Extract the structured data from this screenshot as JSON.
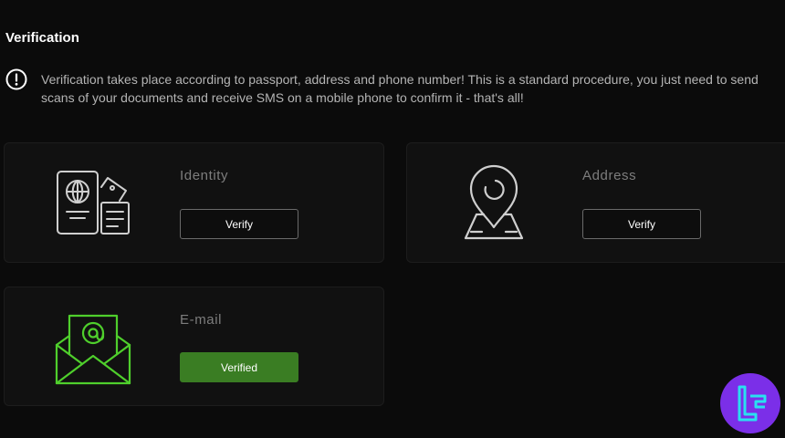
{
  "page": {
    "title": "Verification",
    "notice": "Verification takes place according to passport, address and phone number! This is a standard procedure, you just need to send scans of your documents and receive SMS on a mobile phone to confirm it - that's all!",
    "notice_icon": "exclamation-circle-icon"
  },
  "cards": {
    "identity": {
      "title": "Identity",
      "button_label": "Verify",
      "icon": "passport-icon"
    },
    "address": {
      "title": "Address",
      "button_label": "Verify",
      "icon": "map-pin-icon"
    },
    "email": {
      "title": "E-mail",
      "button_label": "Verified",
      "icon": "envelope-at-icon"
    }
  },
  "colors": {
    "background": "#0b0b0b",
    "card": "#111111",
    "verified": "#3a7d23",
    "icon_gray": "#cfcfcf",
    "icon_green": "#4fcf2c",
    "logo_purple": "#7b2fe8",
    "logo_cyan": "#29e0f0"
  },
  "brand": {
    "icon": "brand-logo"
  }
}
